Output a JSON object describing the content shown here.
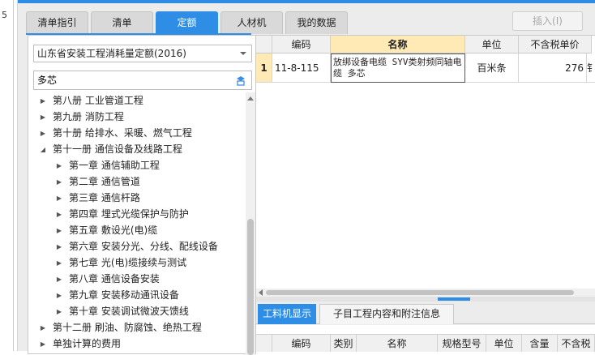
{
  "gutter_number": "5",
  "tabs": [
    "清单指引",
    "清单",
    "定额",
    "人材机",
    "我的数据"
  ],
  "active_tab": 2,
  "insert_button": "插入(I)",
  "norm_library": "山东省安装工程消耗量定额(2016)",
  "search": {
    "value": "多芯",
    "placeholder": ""
  },
  "tree": [
    {
      "label": "第八册 工业管道工程",
      "level": 0,
      "expanded": false
    },
    {
      "label": "第九册 消防工程",
      "level": 0,
      "expanded": false
    },
    {
      "label": "第十册 给排水、采暖、燃气工程",
      "level": 0,
      "expanded": false
    },
    {
      "label": "第十一册 通信设备及线路工程",
      "level": 0,
      "expanded": true
    },
    {
      "label": "第一章 通信辅助工程",
      "level": 1,
      "expanded": false
    },
    {
      "label": "第二章 通信管道",
      "level": 1,
      "expanded": false
    },
    {
      "label": "第三章 通信杆路",
      "level": 1,
      "expanded": false
    },
    {
      "label": "第四章 埋式光缆保护与防护",
      "level": 1,
      "expanded": false
    },
    {
      "label": "第五章 敷设光(电)缆",
      "level": 1,
      "expanded": false
    },
    {
      "label": "第六章 安装分光、分线、配线设备",
      "level": 1,
      "expanded": false
    },
    {
      "label": "第七章 光(电)缆接续与测试",
      "level": 1,
      "expanded": false
    },
    {
      "label": "第八章 通信设备安装",
      "level": 1,
      "expanded": false
    },
    {
      "label": "第九章 安装移动通讯设备",
      "level": 1,
      "expanded": false
    },
    {
      "label": "第十章 安装调试微波天馈线",
      "level": 1,
      "expanded": false
    },
    {
      "label": "第十二册 刷油、防腐蚀、绝热工程",
      "level": 0,
      "expanded": false
    },
    {
      "label": "单独计算的费用",
      "level": 0,
      "expanded": false
    }
  ],
  "grid": {
    "headers": [
      "编码",
      "名称",
      "单位",
      "不含税单价"
    ],
    "rows": [
      {
        "num": "1",
        "code": "11-8-115",
        "name": "放绑设备电缆 SYV类射频同轴电缆 多芯",
        "unit": "百米条",
        "price": "276",
        "extra": "钅"
      }
    ]
  },
  "bottom_tabs": [
    "工料机显示",
    "子目工程内容和附注信息"
  ],
  "bottom_headers": [
    "编码",
    "类别",
    "名称",
    "规格型号",
    "单位",
    "含量",
    "不含税"
  ],
  "colors": {
    "accent": "#2e8ee6",
    "selected_header": "#ffe9b5"
  }
}
